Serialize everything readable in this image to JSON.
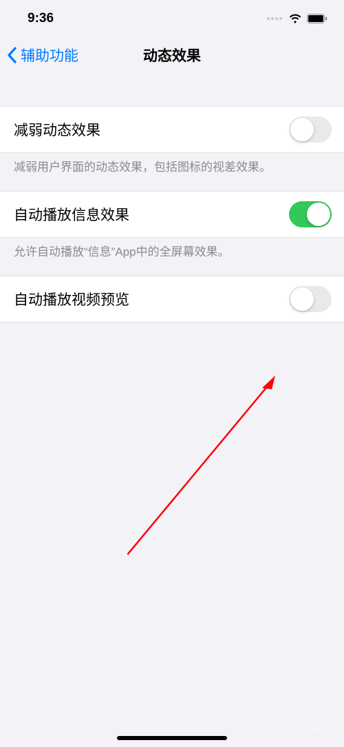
{
  "statusBar": {
    "time": "9:36"
  },
  "nav": {
    "back": "辅助功能",
    "title": "动态效果"
  },
  "rows": {
    "reduceMotion": {
      "label": "减弱动态效果",
      "footer": "减弱用户界面的动态效果，包括图标的视差效果。",
      "on": false
    },
    "autoPlayMessage": {
      "label": "自动播放信息效果",
      "footer": "允许自动播放“信息”App中的全屏幕效果。",
      "on": true
    },
    "autoPlayVideo": {
      "label": "自动播放视频预览",
      "on": false
    }
  },
  "watermark": "Baidu经验"
}
